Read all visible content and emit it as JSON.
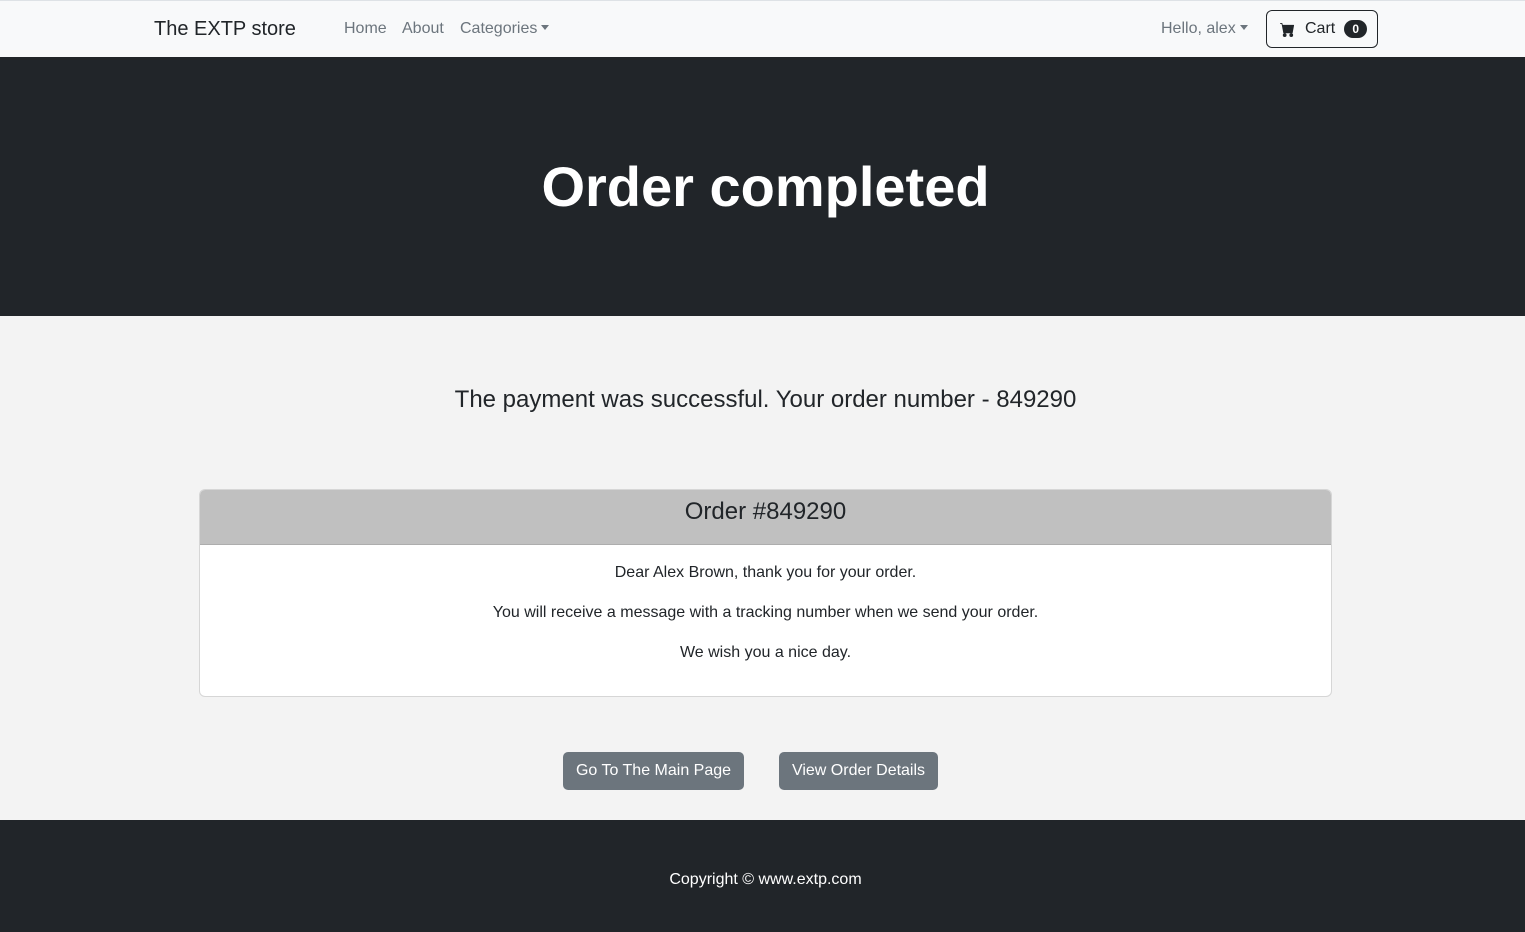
{
  "navbar": {
    "brand": "The EXTP store",
    "links": {
      "home": "Home",
      "about": "About",
      "categories": "Categories"
    },
    "user_greeting": "Hello, alex",
    "cart": {
      "label": "Cart",
      "count": "0",
      "icon": "cart-icon"
    }
  },
  "hero": {
    "title": "Order completed"
  },
  "main": {
    "message": "The payment was successful. Your order number - 849290",
    "order_card": {
      "header": "Order #849290",
      "lines": [
        "Dear Alex Brown, thank you for your order.",
        "You will receive a message with a tracking number when we send your order.",
        "We wish you a nice day."
      ]
    },
    "buttons": {
      "main_page": "Go To The Main Page",
      "order_details": "View Order Details"
    }
  },
  "footer": {
    "copyright": "Copyright © www.extp.com"
  },
  "colors": {
    "navbar_bg": "#f8f9fa",
    "hero_bg": "#212529",
    "page_bg": "#f3f3f3",
    "card_header_bg": "#c0c0c0",
    "button_bg": "#6c757d",
    "footer_bg": "#212529"
  }
}
